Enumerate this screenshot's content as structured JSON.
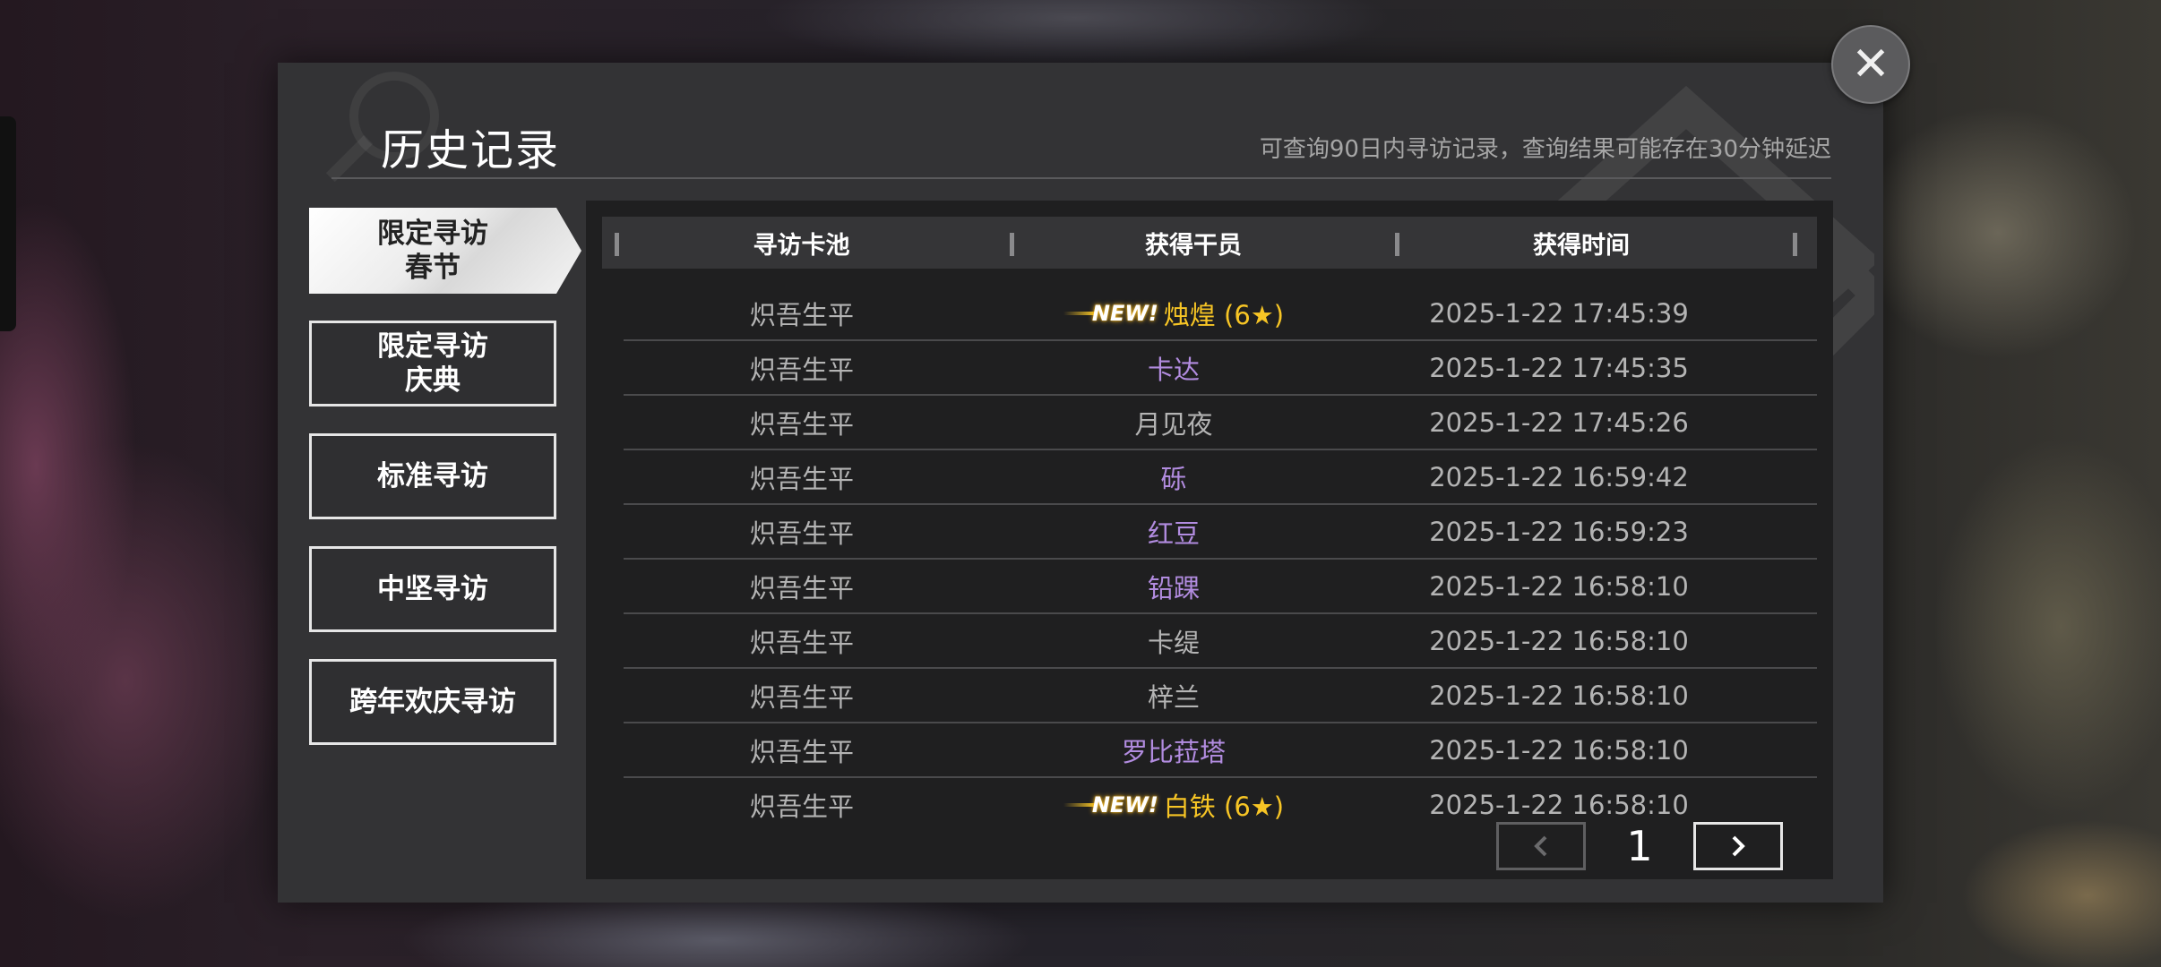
{
  "dialog": {
    "title": "历史记录",
    "subtitle": "可查询90日内寻访记录，查询结果可能存在30分钟延迟",
    "close_label": "✕"
  },
  "tabs": [
    {
      "label": "限定寻访\n春节",
      "active": true
    },
    {
      "label": "限定寻访\n庆典",
      "active": false
    },
    {
      "label": "标准寻访",
      "active": false
    },
    {
      "label": "中坚寻访",
      "active": false
    },
    {
      "label": "跨年欢庆寻访",
      "active": false
    }
  ],
  "table": {
    "headers": [
      "寻访卡池",
      "获得干员",
      "获得时间"
    ],
    "rows": [
      {
        "pool": "炽吾生平",
        "operator": "烛煌 (6★)",
        "rarity": 6,
        "new": true,
        "time": "2025-1-22 17:45:39"
      },
      {
        "pool": "炽吾生平",
        "operator": "卡达",
        "rarity": 4,
        "new": false,
        "time": "2025-1-22 17:45:35"
      },
      {
        "pool": "炽吾生平",
        "operator": "月见夜",
        "rarity": 3,
        "new": false,
        "time": "2025-1-22 17:45:26"
      },
      {
        "pool": "炽吾生平",
        "operator": "砾",
        "rarity": 4,
        "new": false,
        "time": "2025-1-22 16:59:42"
      },
      {
        "pool": "炽吾生平",
        "operator": "红豆",
        "rarity": 4,
        "new": false,
        "time": "2025-1-22 16:59:23"
      },
      {
        "pool": "炽吾生平",
        "operator": "铅踝",
        "rarity": 4,
        "new": false,
        "time": "2025-1-22 16:58:10"
      },
      {
        "pool": "炽吾生平",
        "operator": "卡缇",
        "rarity": 3,
        "new": false,
        "time": "2025-1-22 16:58:10"
      },
      {
        "pool": "炽吾生平",
        "operator": "梓兰",
        "rarity": 3,
        "new": false,
        "time": "2025-1-22 16:58:10"
      },
      {
        "pool": "炽吾生平",
        "operator": "罗比菈塔",
        "rarity": 4,
        "new": false,
        "time": "2025-1-22 16:58:10"
      },
      {
        "pool": "炽吾生平",
        "operator": "白铁 (6★)",
        "rarity": 6,
        "new": true,
        "time": "2025-1-22 16:58:10"
      }
    ],
    "new_badge_text": "NEW!"
  },
  "pager": {
    "page": "1",
    "prev_icon": "chevron-left-icon",
    "next_icon": "chevron-right-icon"
  },
  "colors": {
    "rarity_6": "#f7c525",
    "rarity_4": "#b28ce0",
    "rarity_3": "#b4b4b4"
  }
}
